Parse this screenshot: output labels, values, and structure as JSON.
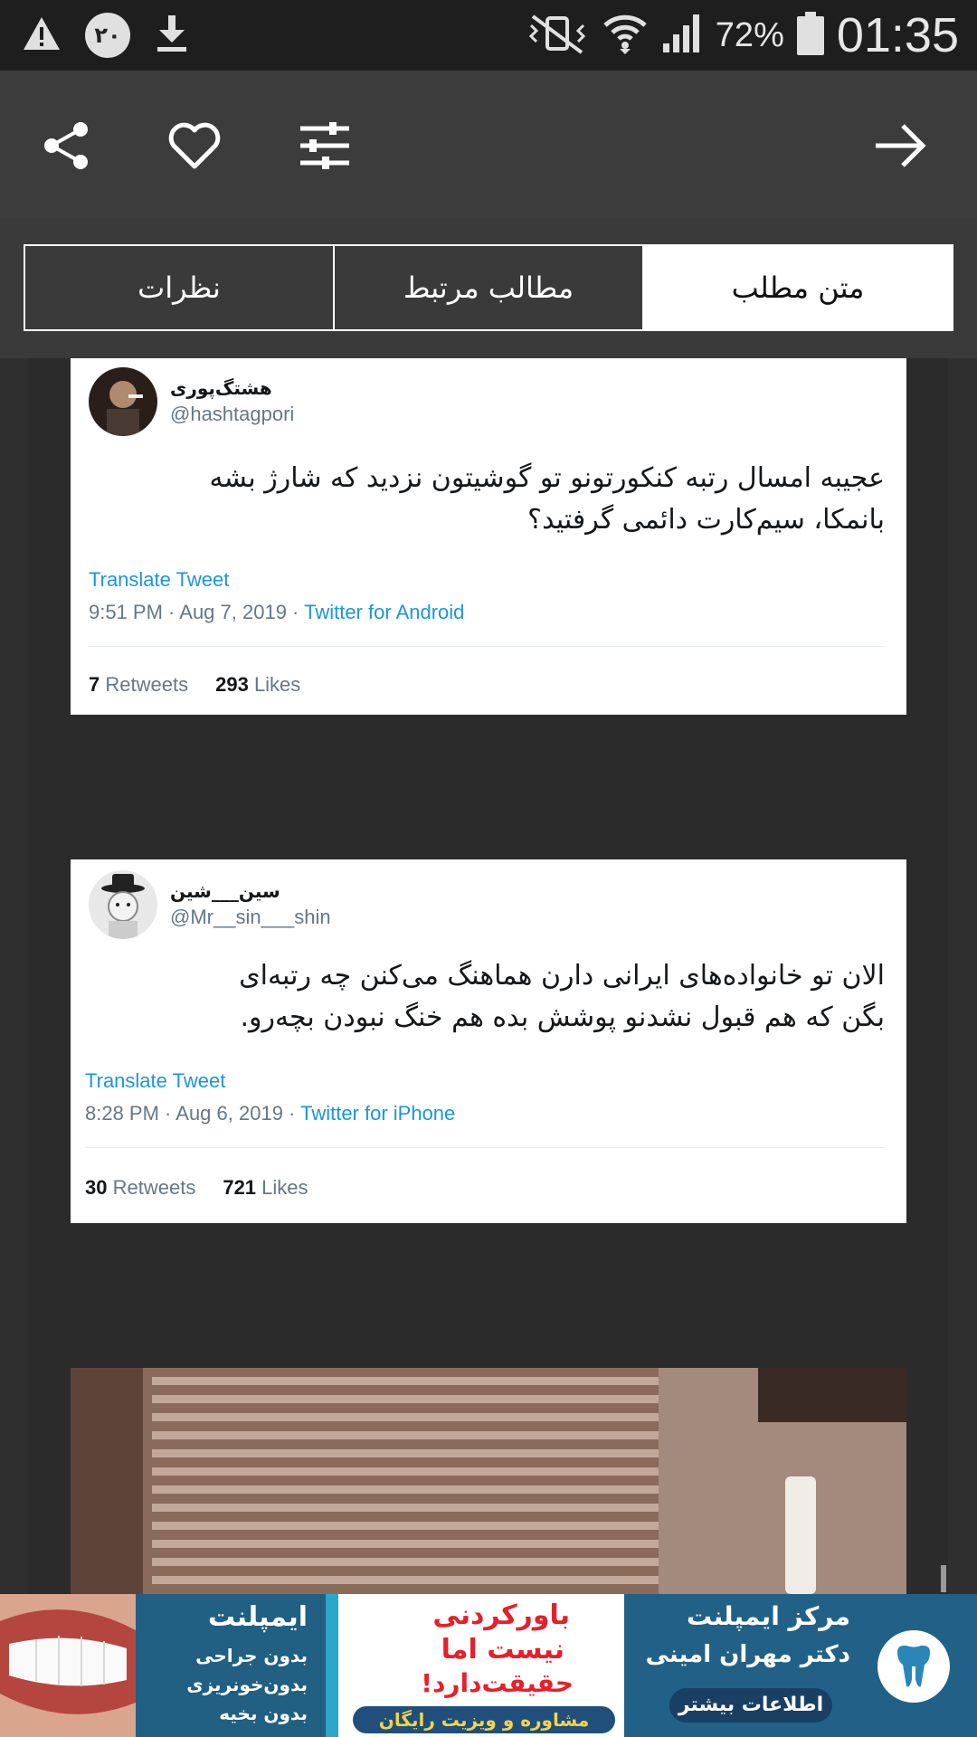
{
  "status_bar": {
    "notification_count": "۲۰",
    "battery": "72%",
    "time": "01:35"
  },
  "toolbar": {
    "icons": [
      "share-icon",
      "heart-icon",
      "sliders-icon",
      "arrow-right-icon"
    ]
  },
  "tabs": {
    "items": [
      {
        "label": "متن مطلب",
        "active": true
      },
      {
        "label": "مطالب مرتبط",
        "active": false
      },
      {
        "label": "نظرات",
        "active": false
      }
    ]
  },
  "tweets": [
    {
      "name": "هشتگ‌پوری",
      "handle": "@hashtagpori",
      "text_line1": "عجیبه امسال رتبه کنکورتونو تو گوشیتون نزدید که شارژ بشه",
      "text_line2": "بانمکا، سیم‌کارت دائمی گرفتید؟",
      "translate": "Translate Tweet",
      "time": "9:51 PM · Aug 7, 2019 · ",
      "source": "Twitter for Android",
      "retweets": "7",
      "retweets_label": "Retweets",
      "likes": "293",
      "likes_label": "Likes"
    },
    {
      "name": "سین___شین",
      "handle": "@Mr__sin___shin",
      "text_line1": "الان تو خانواده‌های ایرانی دارن هماهنگ می‌کنن چه رتبه‌ای",
      "text_line2": "بگن که هم قبول نشدنو پوشش بده هم خنگ نبودن بچه‌رو.",
      "translate": "Translate Tweet",
      "time": "8:28 PM · Aug 6, 2019 · ",
      "source": "Twitter for iPhone",
      "retweets": "30",
      "retweets_label": "Retweets",
      "likes": "721",
      "likes_label": "Likes"
    }
  ],
  "ad": {
    "left_title": "ایمپلنت",
    "left_line1": "بدون جراحی",
    "left_line2": "بدون‌خونریزی",
    "left_line3": "بدون بخیه",
    "mid_line1": "باورکردنی",
    "mid_line2": "نیست اما",
    "mid_line3": "حقیقت‌دارد!",
    "mid_footer": "مشاوره و ویزیت رایگان",
    "right_title": "مرکز ایمپلنت",
    "right_subtitle": "دکتر مهران امینی",
    "right_button": "اطلاعات بیشتر"
  }
}
